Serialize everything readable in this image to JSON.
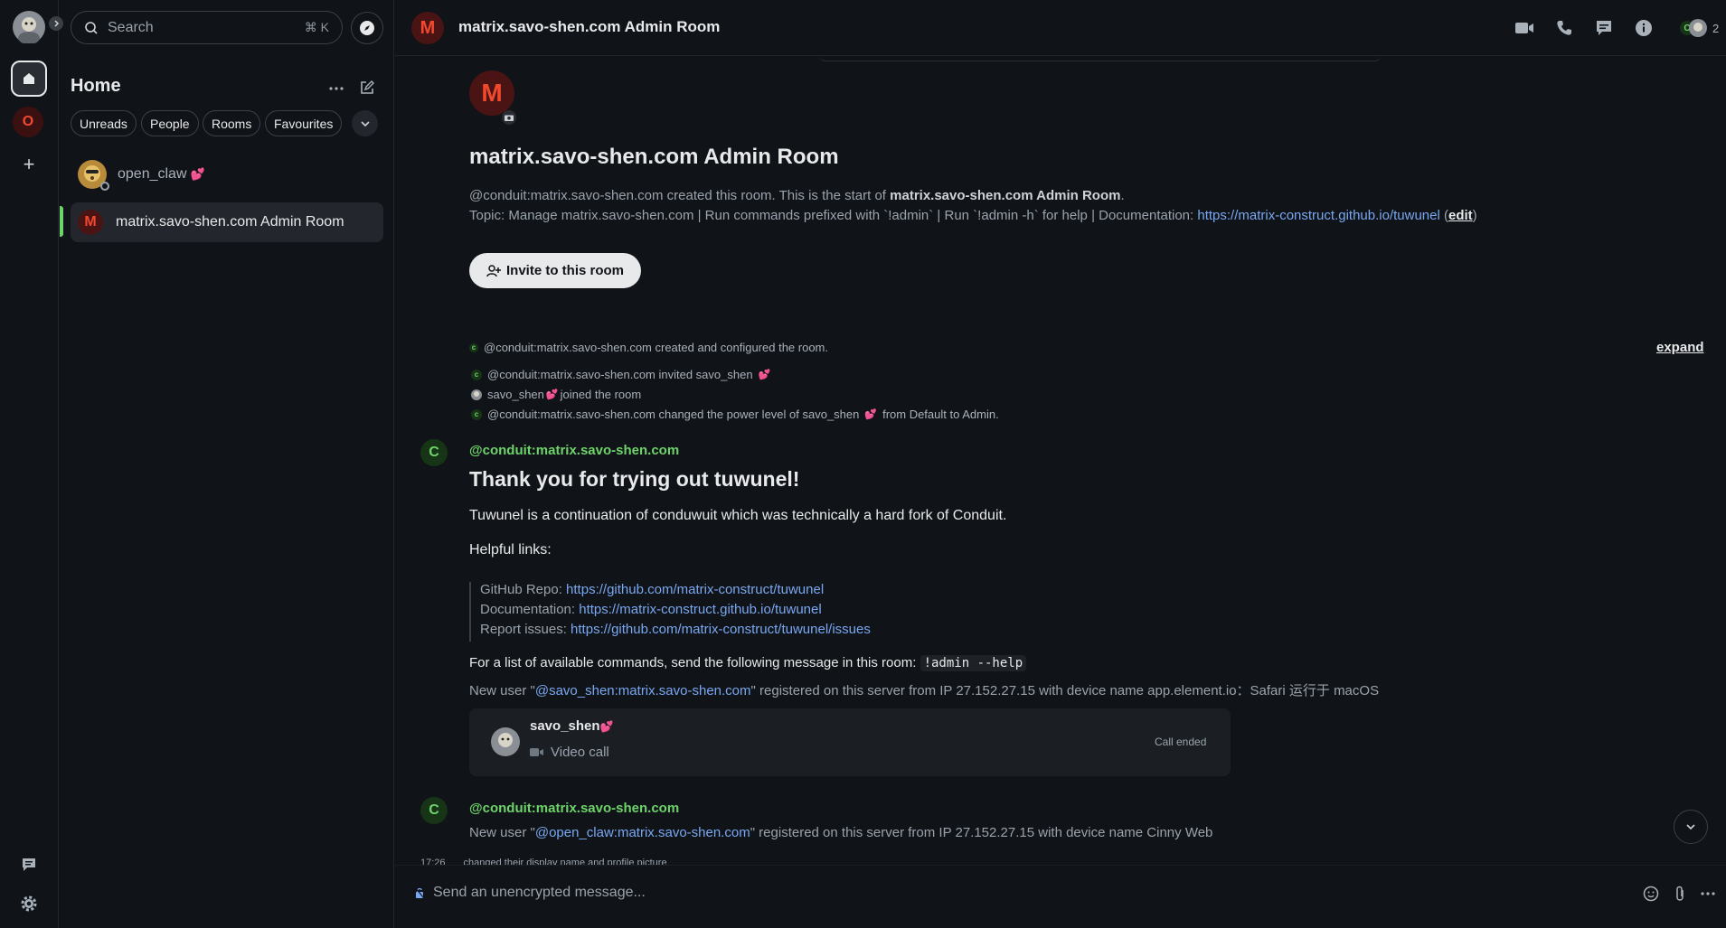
{
  "spaces": {
    "home_tooltip": "Home",
    "space_initial": "O",
    "add_label": "+"
  },
  "left": {
    "search_placeholder": "Search",
    "search_shortcut": "⌘ K",
    "title": "Home",
    "filters": [
      "Unreads",
      "People",
      "Rooms",
      "Favourites"
    ],
    "rooms": [
      {
        "name": "open_claw",
        "emoji": "💕"
      },
      {
        "name": "matrix.savo-shen.com Admin Room",
        "initial": "M"
      }
    ]
  },
  "header": {
    "room_initial": "M",
    "room_name": "matrix.savo-shen.com Admin Room",
    "member_count": "2",
    "member_initial": "C"
  },
  "intro": {
    "avatar_initial": "M",
    "title": "matrix.savo-shen.com Admin Room",
    "created_prefix": "@conduit:matrix.savo-shen.com created this room. This is the start of ",
    "created_room": "matrix.savo-shen.com Admin Room",
    "created_suffix": ".",
    "topic_prefix": "Topic: Manage matrix.savo-shen.com | Run commands prefixed with `!admin` | Run `!admin -h` for help | Documentation: ",
    "topic_link": "https://matrix-construct.github.io/tuwunel",
    "topic_edit_open": " (",
    "topic_edit": "edit",
    "topic_edit_close": ")",
    "invite_label": "Invite to this room"
  },
  "events": {
    "created": "@conduit:matrix.savo-shen.com created and configured the room.",
    "expand": "expand",
    "invited": "@conduit:matrix.savo-shen.com invited savo_shen",
    "joined_name": "savo_shen",
    "joined_suffix": "joined the room",
    "power_prefix": "@conduit:matrix.savo-shen.com changed the power level of savo_shen",
    "power_suffix": "from Default to Admin.",
    "heart": "💕"
  },
  "message1": {
    "avatar_initial": "C",
    "sender": "@conduit:matrix.savo-shen.com",
    "heading": "Thank you for trying out tuwunel!",
    "para1": "Tuwunel is a continuation of conduwuit which was technically a hard fork of Conduit.",
    "para2": "Helpful links:",
    "links": [
      {
        "label": "GitHub Repo: ",
        "url": "https://github.com/matrix-construct/tuwunel"
      },
      {
        "label": "Documentation: ",
        "url": "https://matrix-construct.github.io/tuwunel"
      },
      {
        "label": "Report issues: ",
        "url": "https://github.com/matrix-construct/tuwunel/issues"
      }
    ],
    "commands_text": "For a list of available commands, send the following message in this room:",
    "commands_code": "!admin --help",
    "newuser_prefix": "New user \"",
    "newuser_link": "@savo_shen:matrix.savo-shen.com",
    "newuser_suffix": "\" registered on this server from IP 27.152.27.15 with device name app.element.io：Safari 运行于 macOS"
  },
  "call": {
    "name": "savo_shen",
    "heart": "💕",
    "type": "Video call",
    "status": "Call ended"
  },
  "message2": {
    "avatar_initial": "C",
    "sender": "@conduit:matrix.savo-shen.com",
    "newuser_prefix": "New user \"",
    "newuser_link": "@open_claw:matrix.savo-shen.com",
    "newuser_suffix": "\" registered on this server from IP 27.152.27.15 with device name Cinny Web",
    "partial_time": "17:26",
    "partial_text": "changed their display name and profile picture"
  },
  "composer": {
    "placeholder": "Send an unencrypted message..."
  },
  "colors": {
    "background": "#101317",
    "accent_green": "#6dd36a",
    "link_blue": "#79a8f2",
    "avatar_red": "#f2482e"
  }
}
